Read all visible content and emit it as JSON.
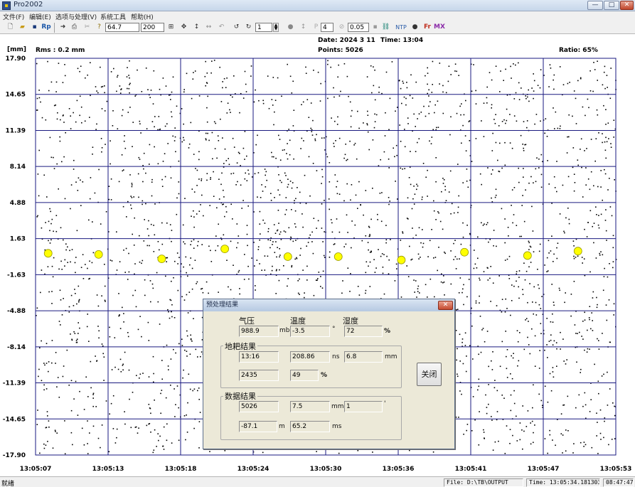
{
  "window": {
    "title": "Pro2002",
    "min_glyph": "—",
    "max_glyph": "□",
    "close_glyph": "✕"
  },
  "menu": [
    {
      "id": "file",
      "label": "文件(F)"
    },
    {
      "id": "edit",
      "label": "编辑(E)"
    },
    {
      "id": "options",
      "label": "选项与处理(V)"
    },
    {
      "id": "tools",
      "label": "系统工具"
    },
    {
      "id": "help",
      "label": "帮助(H)"
    }
  ],
  "toolbar": {
    "field1": "64.7",
    "field2": "200",
    "field3": "1",
    "field4": "4",
    "field5": "0.05",
    "rp_label": "Rp",
    "ntp_label": "NTP",
    "fr_label": "Fr",
    "mx_label": "MX"
  },
  "header": {
    "date": "Date: 2024  3 11",
    "time": "Time: 13:04",
    "points": "Points: 5026",
    "rms": "Rms :  0.2 mm",
    "ratio": "Ratio:  65%",
    "unit": "[mm]"
  },
  "colors": {
    "grid": "#1a1a80",
    "marker": "#ffff00",
    "marker_stroke": "#999900",
    "dot": "#000000"
  },
  "chart_data": {
    "type": "scatter",
    "ylabel": "[mm]",
    "ylim": [
      -17.9,
      17.9
    ],
    "y_ticks": [
      "17.90",
      "14.65",
      "11.39",
      "8.14",
      "4.88",
      "1.63",
      "-1.63",
      "-4.88",
      "-8.14",
      "-11.39",
      "-14.65",
      "-17.90"
    ],
    "x_ticks": [
      "13:05:07",
      "13:05:13",
      "13:05:18",
      "13:05:24",
      "13:05:30",
      "13:05:36",
      "13:05:41",
      "13:05:47",
      "13:05:53"
    ],
    "points_count": 5026,
    "markers": {
      "x": [
        "13:05:08",
        "13:05:12",
        "13:05:17",
        "13:05:22",
        "13:05:27",
        "13:05:31",
        "13:05:36",
        "13:05:41",
        "13:05:46",
        "13:05:50"
      ],
      "y": [
        0.3,
        0.2,
        -0.2,
        0.7,
        0.0,
        0.0,
        -0.3,
        0.4,
        0.1,
        0.5
      ]
    }
  },
  "dialog": {
    "title": "预处理结果",
    "close_glyph": "✕",
    "labels": {
      "pressure": "气压",
      "temp": "温度",
      "humidity": "湿度"
    },
    "pressure_value": "988.9",
    "pressure_unit": "mb",
    "temp_value": "-3.5",
    "temp_unit": "°",
    "humidity_value": "72",
    "humidity_unit": "%",
    "group1": {
      "title": "地耙结果",
      "r1c1": "13:16",
      "r1c2": "208.86",
      "r1c2_unit": "ns",
      "r1c3": "6.8",
      "r1c3_unit": "mm",
      "r2c1": "2435",
      "r2c2": "49",
      "r2c2_unit": "%"
    },
    "group2": {
      "title": "数据结果",
      "r1c1": "5026",
      "r1c2": "7.5",
      "r1c2_unit": "mm",
      "r1c3": "1",
      "r1c3_unit": "'",
      "r2c1": "-87.1",
      "r2c1_unit": "m",
      "r2c2": "65.2",
      "r2c2_unit": "ms"
    },
    "close_button": "关闭"
  },
  "status": {
    "main": "就绪",
    "file": "File: D:\\TB\\OUTPUT",
    "time": "Time: 13:05:34.1813030",
    "clock": "08:47:47"
  }
}
